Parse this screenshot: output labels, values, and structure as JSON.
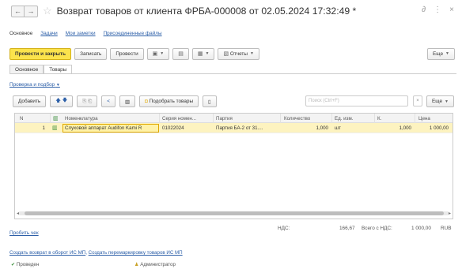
{
  "window": {
    "title": "Возврат товаров от клиента ФРБА-000008 от 02.05.2024 17:32:49 *",
    "back_icon": "arrow-left-icon",
    "forward_icon": "arrow-right-icon",
    "favorite_icon": "star-icon",
    "link_icon": "link-icon",
    "menu_icon": "more-vertical-icon",
    "close_icon": "close-icon"
  },
  "section_tabs": [
    {
      "label": "Основное",
      "active": true
    },
    {
      "label": "Задачи",
      "active": false
    },
    {
      "label": "Мои заметки",
      "active": false
    },
    {
      "label": "Присоединенные файлы",
      "active": false
    }
  ],
  "toolbar": {
    "post_close": "Провести и закрыть",
    "save": "Записать",
    "post": "Провести",
    "reports": "Отчеты",
    "more": "Еще"
  },
  "tabs": [
    {
      "label": "Основное",
      "active": false
    },
    {
      "label": "Товары",
      "active": true
    }
  ],
  "pick_menu": "Проверка и подбор",
  "table_toolbar": {
    "add": "Добавить",
    "pick_goods": "Подобрать товары",
    "search_placeholder": "Поиск (Ctrl+F)",
    "clear": "×",
    "more": "Еще"
  },
  "table": {
    "columns": [
      "N",
      "Номенклатура",
      "Серия номен...",
      "Партия",
      "Количество",
      "Ед. изм.",
      "К.",
      "Цена"
    ],
    "rows": [
      {
        "n": "1",
        "item": "Слуховой аппарат Audifon Kami R",
        "series": "01022024",
        "batch": "Партия БА-2 от 31....",
        "qty": "1,000",
        "unit": "шт",
        "k": "1,000",
        "price": "1 000,00"
      }
    ]
  },
  "footer": {
    "check_link": "Пробить чек",
    "vat_label": "НДС:",
    "vat_value": "166,67",
    "total_label": "Всего с НДС:",
    "total_value": "1 000,00",
    "currency": "RUB",
    "link_return": "Создать возврат в оборот ИС МП",
    "link_relabel": "Создать перемаркировку товаров ИС МП",
    "status_posted": "Проведен",
    "status_user": "Администратор"
  }
}
